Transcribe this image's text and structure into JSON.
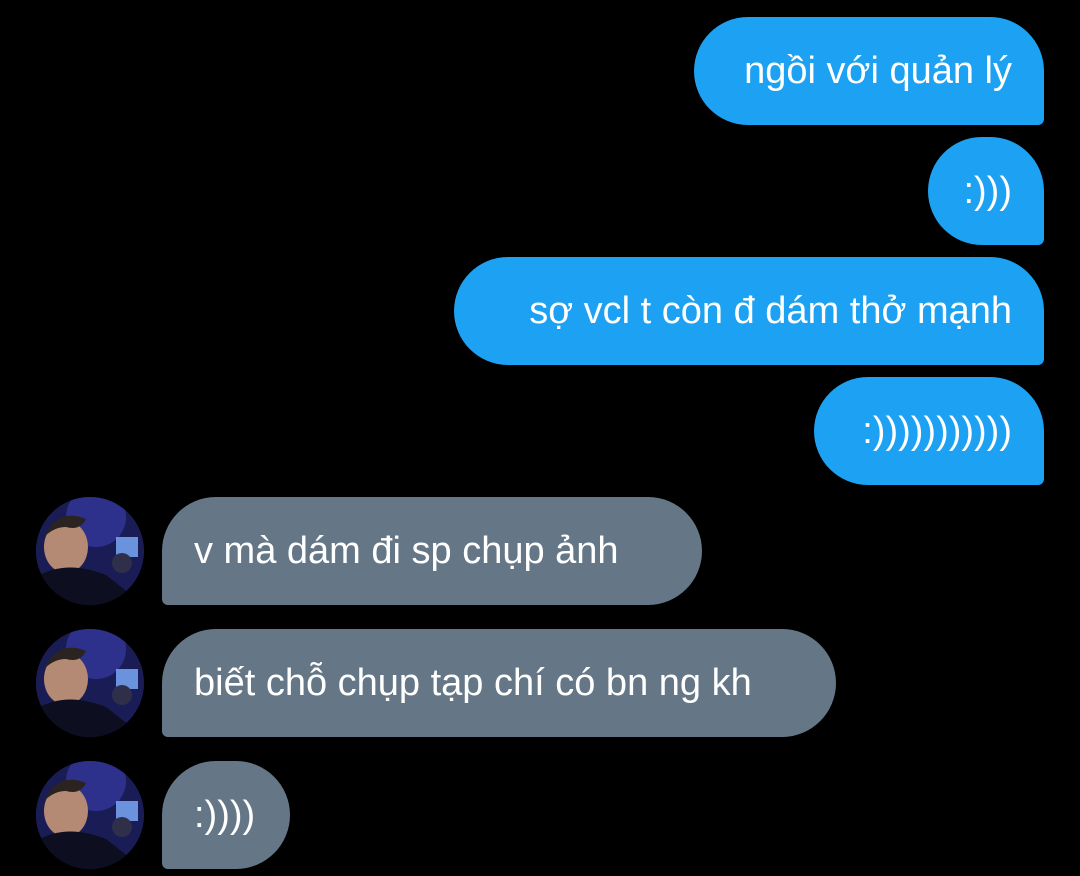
{
  "messages": [
    {
      "side": "sent",
      "text": "ngồi với quản lý"
    },
    {
      "side": "sent",
      "text": ":)))"
    },
    {
      "side": "sent",
      "text": "sợ vcl t còn đ dám thở mạnh"
    },
    {
      "side": "sent",
      "text": ":)))))))))))"
    },
    {
      "side": "received",
      "text": "v mà dám đi sp chụp ảnh"
    },
    {
      "side": "received",
      "text": "biết chỗ chụp tạp chí có bn ng kh"
    },
    {
      "side": "received",
      "text": ":))))"
    }
  ],
  "icons": {
    "avatar": "contact-avatar-photo"
  },
  "colors": {
    "background": "#000000",
    "sent_bubble": "#1da1f2",
    "received_bubble": "#657786",
    "text": "#ffffff"
  }
}
